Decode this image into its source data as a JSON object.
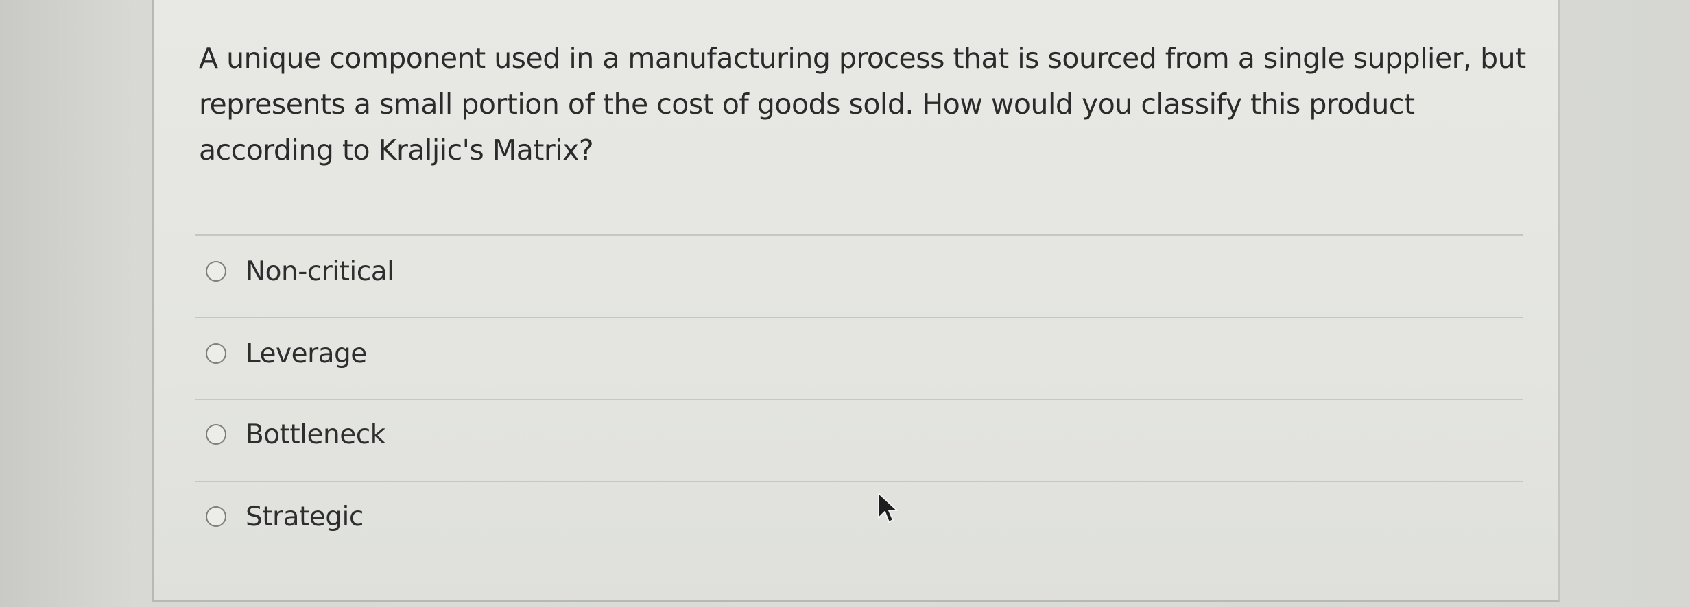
{
  "question": {
    "text": "A unique component used in a manufacturing process that is sourced from a single supplier, but represents a small portion of the cost of goods sold. How would you classify this product according to Kraljic's Matrix?"
  },
  "options": [
    {
      "label": "Non-critical",
      "selected": false
    },
    {
      "label": "Leverage",
      "selected": false
    },
    {
      "label": "Bottleneck",
      "selected": false
    },
    {
      "label": "Strategic",
      "selected": false
    }
  ],
  "cursor": {
    "icon": "mouse-pointer-icon"
  }
}
